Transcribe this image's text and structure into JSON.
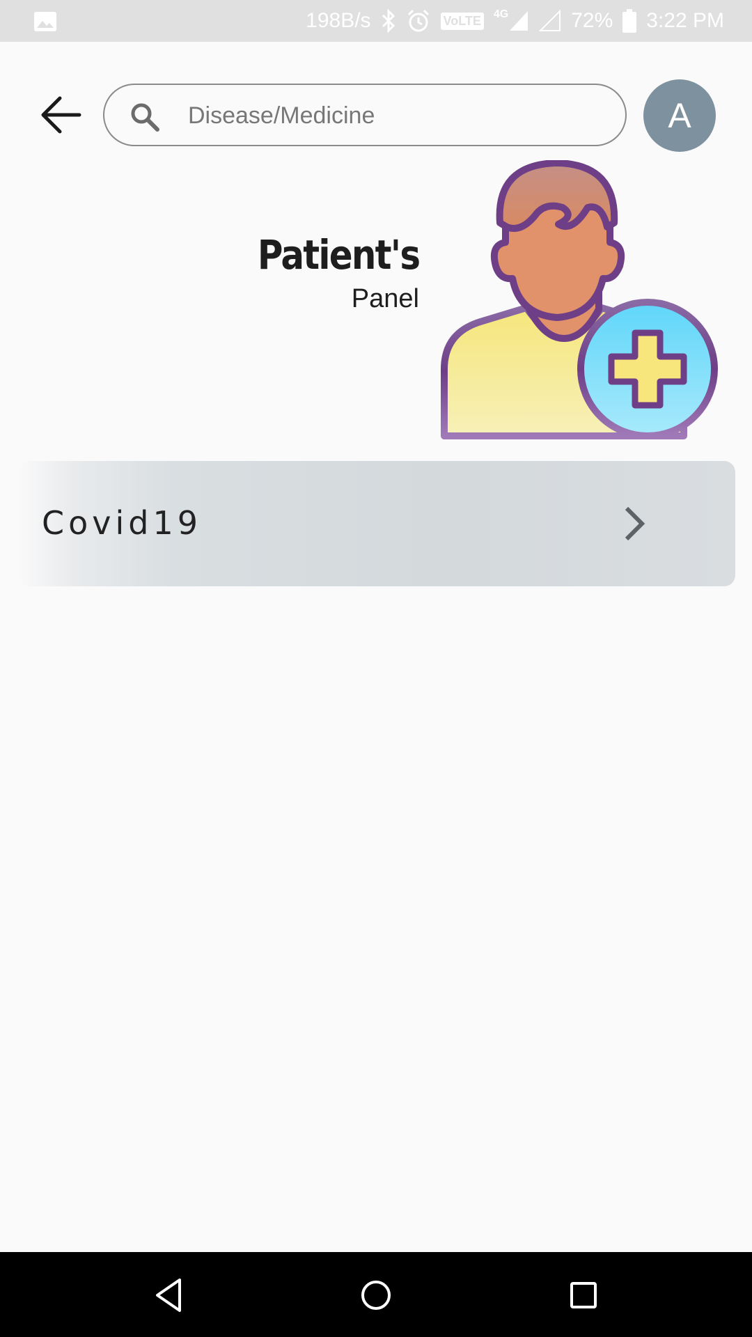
{
  "status_bar": {
    "network_speed": "198B/s",
    "network_type": "4G",
    "volte_label": "VoLTE",
    "battery_level": "72%",
    "time": "3:22 PM",
    "icons": [
      "image-icon",
      "bluetooth-icon",
      "alarm-icon",
      "signal-icon",
      "battery-icon"
    ]
  },
  "search": {
    "placeholder": "Disease/Medicine",
    "value": ""
  },
  "avatar": {
    "initial": "A",
    "color": "#7d919f"
  },
  "header": {
    "title": "Patient's",
    "subtitle": "Panel"
  },
  "list": {
    "items": [
      {
        "label": "Covid19"
      }
    ]
  },
  "colors": {
    "background": "#fafafa",
    "status_bar": "#e0e0e0",
    "list_item": "#d4d9dc",
    "nav_bar": "#000000"
  }
}
